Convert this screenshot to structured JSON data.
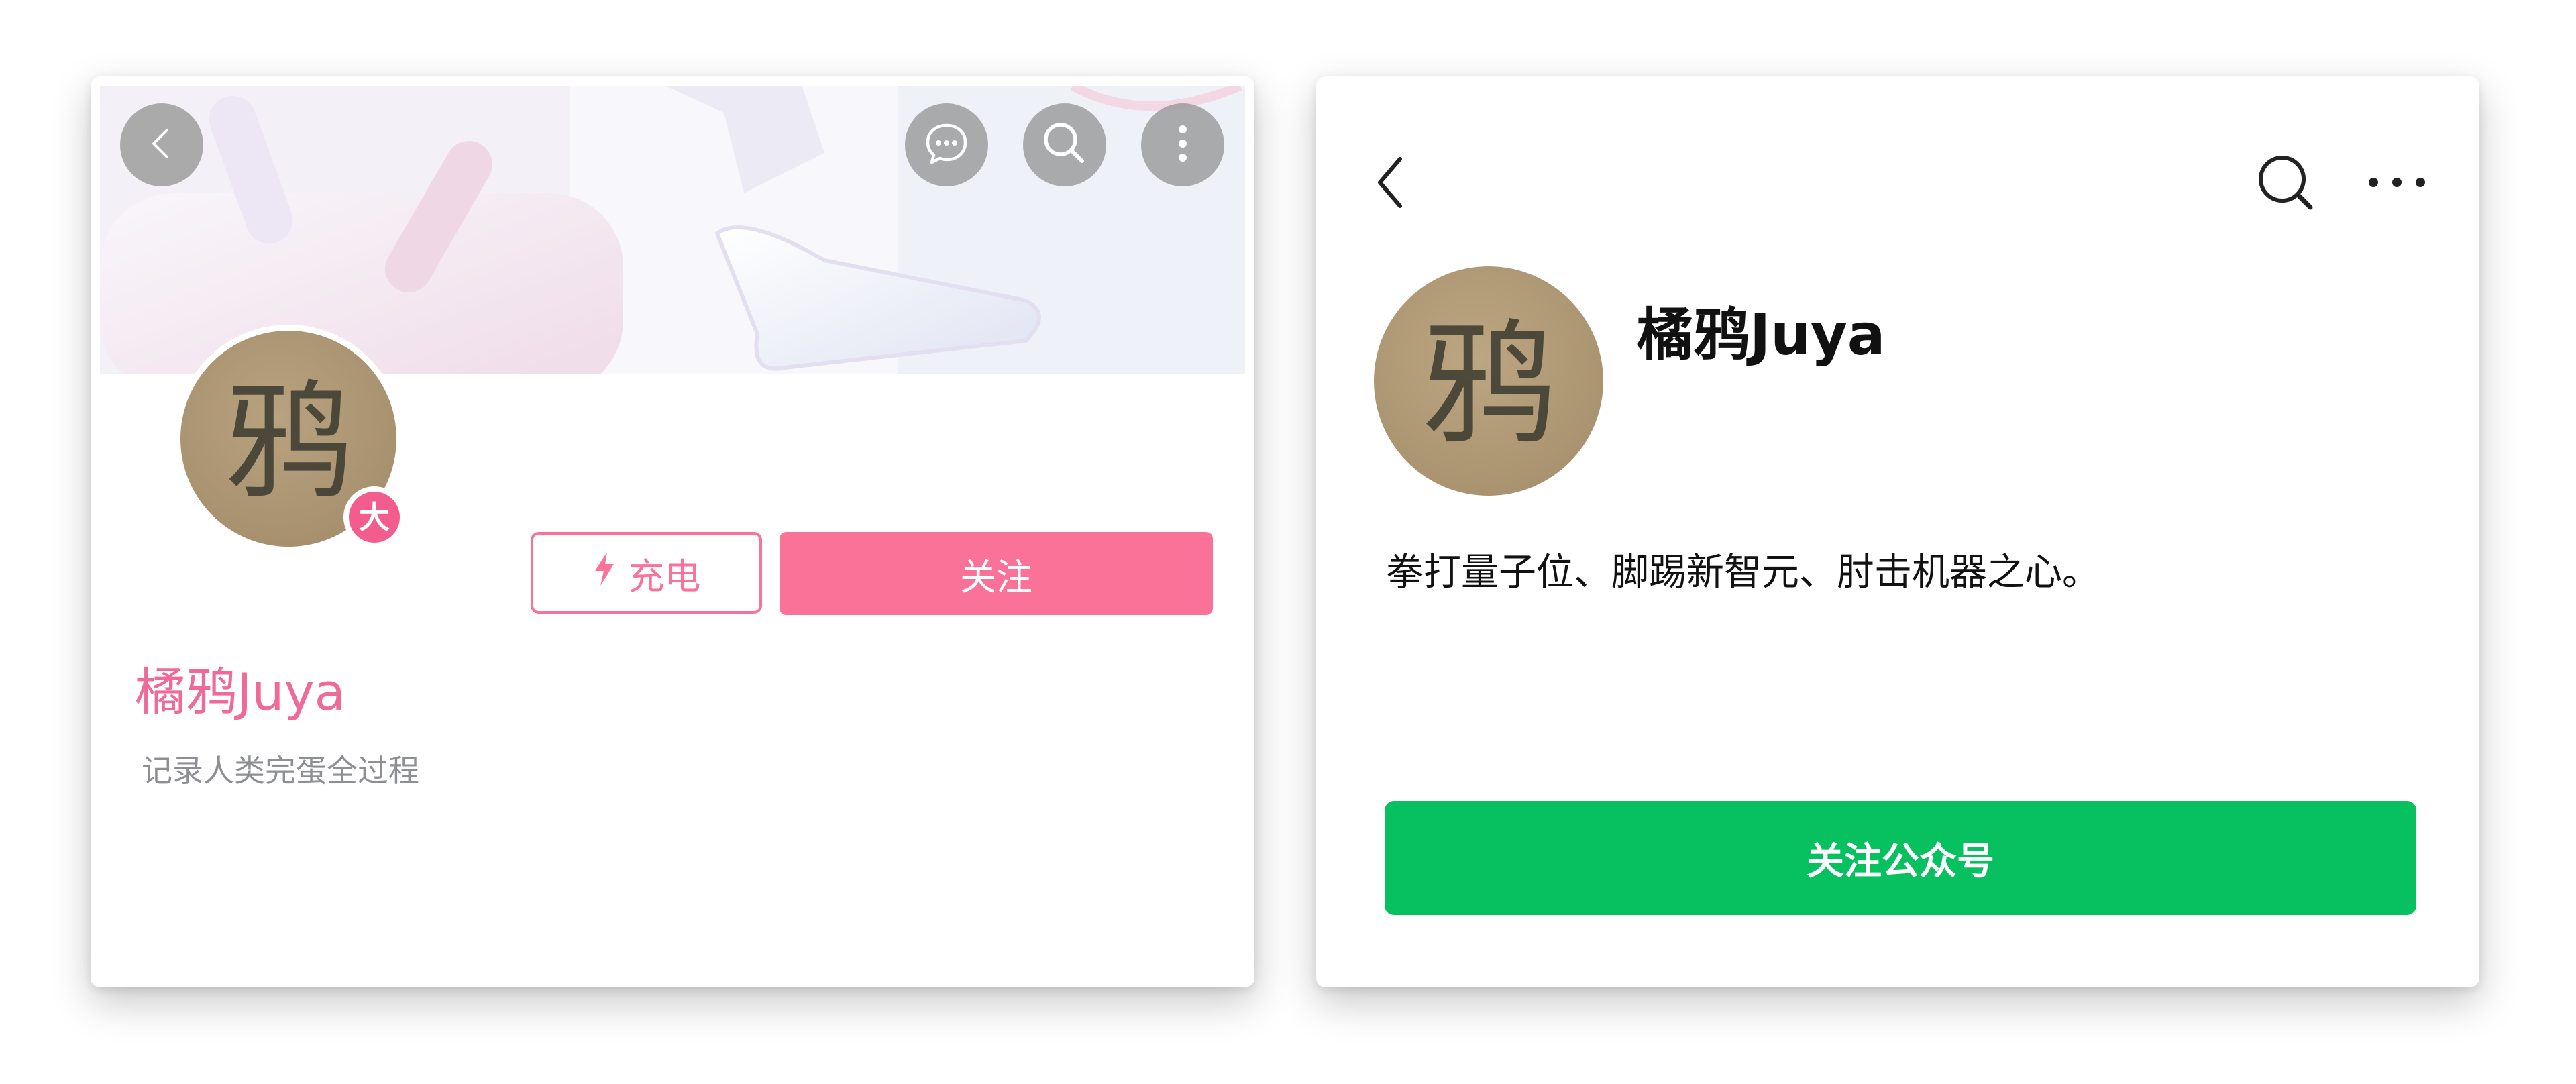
{
  "left_card": {
    "nav": {
      "back_icon": "chevron-left-icon",
      "message_icon": "chat-bubble-icon",
      "search_icon": "search-icon",
      "more_icon": "vertical-dots-icon"
    },
    "avatar_glyph": "鸦",
    "badge_text": "大",
    "charge_icon": "lightning-icon",
    "charge_label": "充电",
    "follow_label": "关注",
    "username": "橘鸦Juya",
    "signature": "记录人类完蛋全过程",
    "colors": {
      "accent": "#fb7299",
      "username": "#f06a99",
      "badge": "#f25d8e"
    }
  },
  "right_card": {
    "nav": {
      "back_icon": "chevron-left-icon",
      "search_icon": "search-icon",
      "more_icon": "horizontal-dots-icon"
    },
    "avatar_glyph": "鸦",
    "username": "橘鸦Juya",
    "description": "拳打量子位、脚踢新智元、肘击机器之心。",
    "follow_label": "关注公众号",
    "colors": {
      "accent": "#07c160"
    }
  }
}
